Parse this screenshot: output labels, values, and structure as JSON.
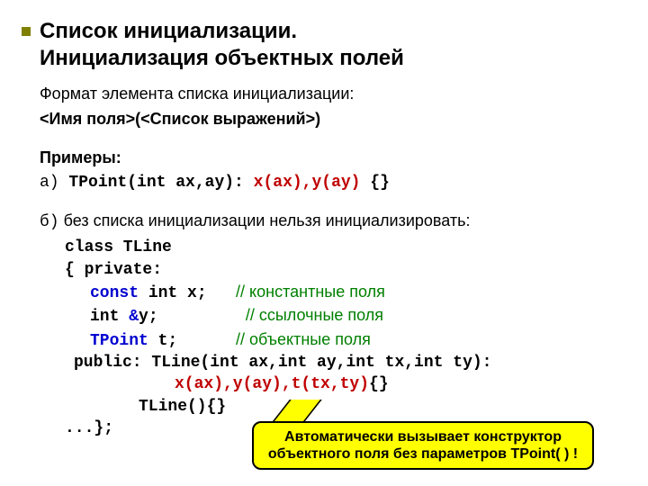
{
  "title_line1": "Список инициализации.",
  "title_line2": "Инициализация объектных полей",
  "format_intro": "Формат элемента списка инициализации:",
  "format_template": "<Имя поля>(<Список выражений>)",
  "examples_label": "Примеры:",
  "ex_a": {
    "marker": "а)",
    "prefix": "TPoint(int ax,ay):",
    "red_part": " x(ax),y(ay) ",
    "suffix": "{}"
  },
  "ex_b": {
    "marker": "б)",
    "text": "без списка инициализации нельзя инициализировать:"
  },
  "code": {
    "l1": "class TLine",
    "l2": "{ private:",
    "l3_kw": "const",
    "l3_rest": " int x;",
    "l3_comment": "// константные поля",
    "l4_pre": "int ",
    "l4_amp": "&",
    "l4_post": "y;",
    "l4_comment": "// ссылочные поля",
    "l5_type": "TPoint",
    "l5_rest": " t;",
    "l5_comment": "// объектные поля",
    "l6": "public: TLine(int ax,int ay,int tx,int ty):",
    "l7_red": "x(ax),y(ay),t(tx,ty)",
    "l7_suffix": "{}",
    "l8": "TLine(){}",
    "l9": "...};"
  },
  "callout_text": "Автоматически вызывает конструктор объектного поля без параметров TPoint( ) !"
}
